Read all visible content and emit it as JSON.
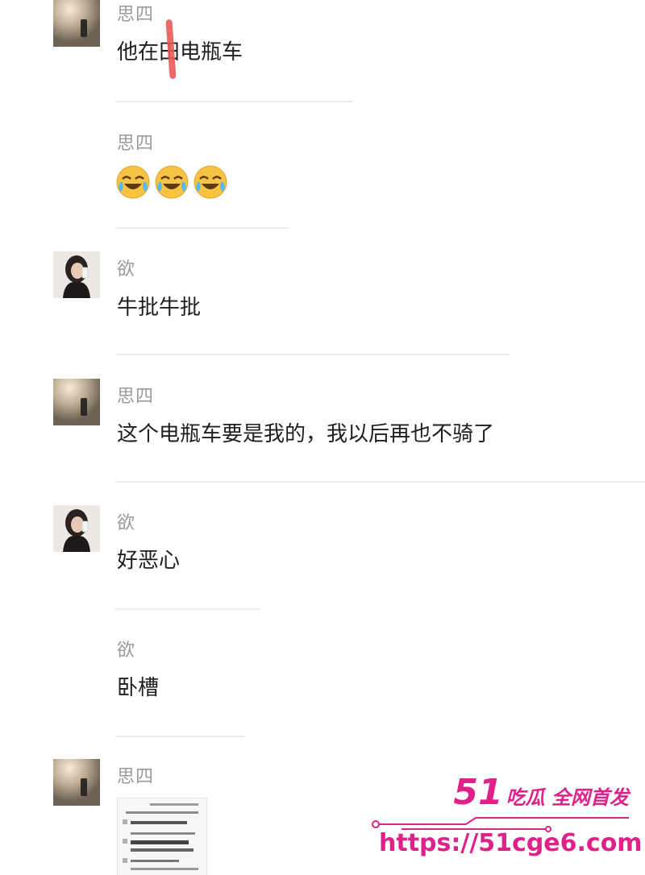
{
  "messages": [
    {
      "name": "思四",
      "text": "他在田电瓶车"
    },
    {
      "name": "思四",
      "text": ""
    },
    {
      "name": "欲",
      "text": "牛批牛批"
    },
    {
      "name": "思四",
      "text": "这个电瓶车要是我的，我以后再也不骑了"
    },
    {
      "name": "欲",
      "text": "好恶心"
    },
    {
      "name": "欲",
      "text": "卧槽"
    },
    {
      "name": "思四",
      "text": ""
    }
  ],
  "emoji_icons": [
    "crying-laughing-emoji-icon",
    "crying-laughing-emoji-icon",
    "crying-laughing-emoji-icon"
  ],
  "watermark": {
    "number": "51",
    "tagline": "吃瓜 全网首发",
    "url": "https://51cge6.com"
  },
  "colors": {
    "text": "#1e1e1e",
    "name": "#9a9a9a",
    "divider": "#ececec",
    "watermark": "#e0218a",
    "annotation": "#e85a5a"
  }
}
